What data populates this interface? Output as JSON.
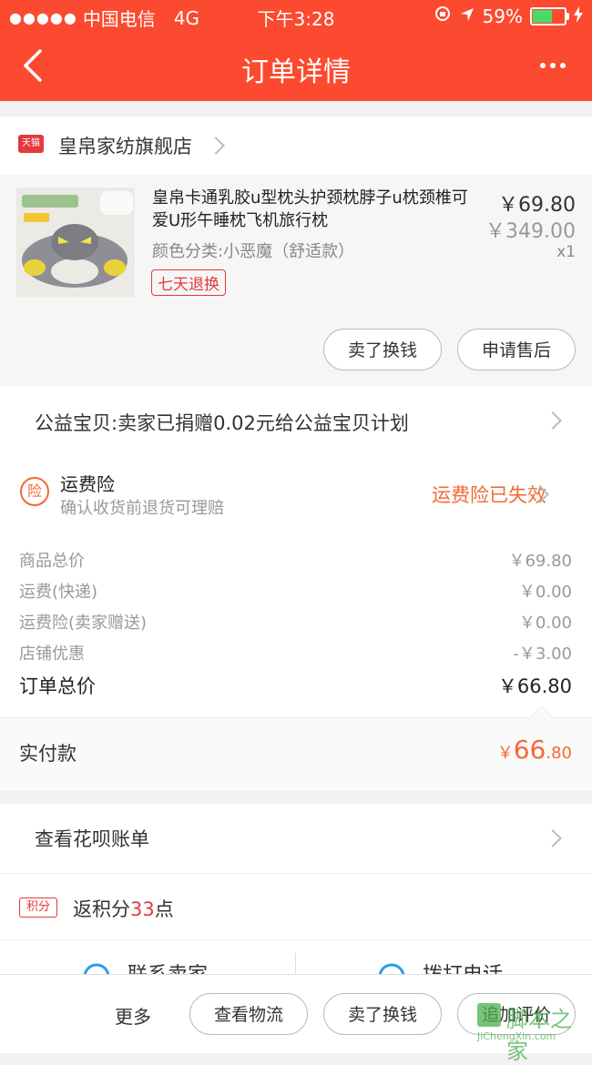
{
  "status_bar": {
    "signal": "●●●●●",
    "carrier": "中国电信",
    "network": "4G",
    "time": "下午3:28",
    "battery": "59%"
  },
  "nav": {
    "title": "订单详情"
  },
  "shop": {
    "badge": "天猫",
    "name": "皇帛家纺旗舰店"
  },
  "product": {
    "title": "皇帛卡通乳胶u型枕头护颈枕脖子u枕颈椎可爱U形午睡枕飞机旅行枕",
    "sku": "颜色分类:小恶魔（舒适款）",
    "tag": "七天退换",
    "price": "￥69.80",
    "original_price": "￥349.00",
    "quantity": "x1",
    "buttons": [
      "卖了换钱",
      "申请售后"
    ]
  },
  "charity": {
    "text": "公益宝贝:卖家已捐赠0.02元给公益宝贝计划"
  },
  "insurance": {
    "icon": "险",
    "title": "运费险",
    "subtitle": "确认收货前退货可理赔",
    "status": "运费险已失效"
  },
  "price_rows": [
    {
      "label": "商品总价",
      "value": "￥69.80"
    },
    {
      "label": "运费(快递)",
      "value": "￥0.00"
    },
    {
      "label": "运费险(卖家赠送)",
      "value": "￥0.00"
    },
    {
      "label": "店铺优惠",
      "value": "-￥3.00"
    }
  ],
  "order_total": {
    "label": "订单总价",
    "value": "￥66.80"
  },
  "paid": {
    "label": "实付款",
    "currency": "￥",
    "integer": "66",
    "decimal": ".80"
  },
  "huabei": {
    "label": "查看花呗账单"
  },
  "points": {
    "badge": "积分",
    "prefix": "返积分",
    "number": "33",
    "suffix": "点"
  },
  "contact": {
    "seller": "联系卖家",
    "phone": "拨打电话"
  },
  "bottom_bar": {
    "more": "更多",
    "buttons": [
      "查看物流",
      "卖了换钱",
      "追加评价"
    ]
  },
  "watermark": {
    "name": "脚本之家",
    "url": "JiChengXin.com"
  },
  "colors": {
    "brand": "#fb4a2f",
    "accent_orange": "#f26a32",
    "tmall_red": "#e4393c"
  }
}
